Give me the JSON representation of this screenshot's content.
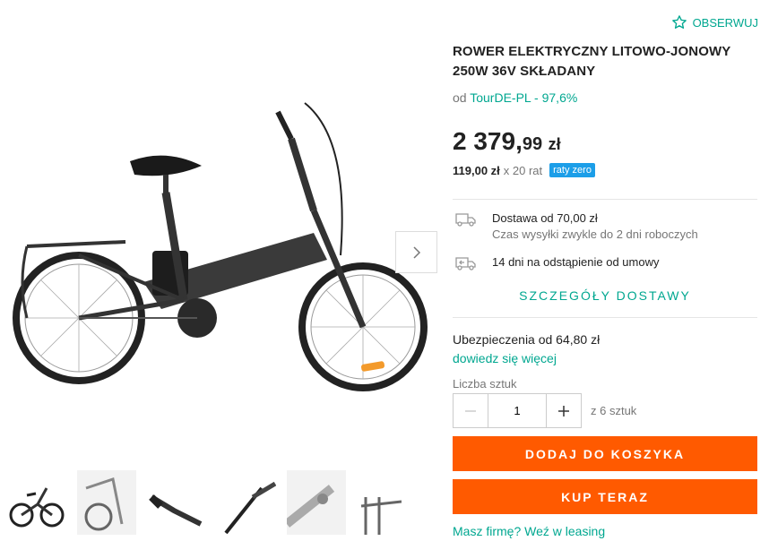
{
  "colors": {
    "accent": "#00a790",
    "cta": "#ff5a00",
    "badge": "#1c9ee8"
  },
  "watch": {
    "label": "OBSERWUJ",
    "icon": "star-outline-icon"
  },
  "product": {
    "title": "ROWER ELEKTRYCZNY LITOWO-JONOWY 250W 36V SKŁADANY",
    "seller_prefix": "od",
    "seller": "TourDE-PL - 97,6%",
    "price_main": "2 379,",
    "price_cents": "99",
    "price_currency": "zł",
    "installment_amount": "119,00 zł",
    "installment_count": "x 20 rat",
    "installment_badge": "raty zero"
  },
  "delivery": {
    "line1": "Dostawa od 70,00 zł",
    "line2": "Czas wysyłki zwykle do 2 dni roboczych",
    "returns": "14 dni na odstąpienie od umowy",
    "details_link": "SZCZEGÓŁY DOSTAWY"
  },
  "insurance": {
    "label": "Ubezpieczenia od 64,80 zł",
    "link": "dowiedz się więcej"
  },
  "quantity": {
    "label": "Liczba sztuk",
    "value": "1",
    "of": "z 6 sztuk"
  },
  "buttons": {
    "add_to_cart": "DODAJ DO KOSZYKA",
    "buy_now": "KUP TERAZ"
  },
  "leasing": "Masz firmę? Weź w leasing"
}
